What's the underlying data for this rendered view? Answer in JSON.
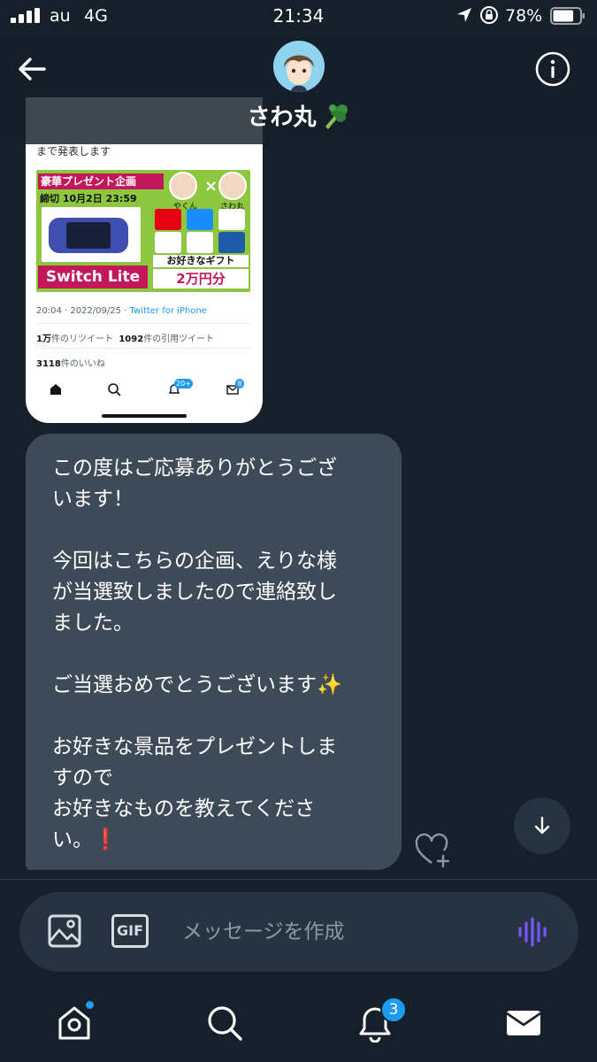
{
  "status_bar": {
    "carrier": "au",
    "network": "4G",
    "time": "21:34",
    "battery_percent": "78%",
    "battery_level": 0.78
  },
  "header": {
    "contact_name": "さわ丸",
    "name_emoji_icon": "broccoli-icon",
    "back_icon": "arrow-left-icon",
    "info_icon": "info-circle-icon"
  },
  "attached_screenshot": {
    "top_text": "まで発表します",
    "promo": {
      "heading": "豪華プレゼント企画",
      "deadline": "締切 10月2日 23:59",
      "product": "Switch Lite",
      "lite_label": "Lite",
      "times": "×",
      "host1": "やくん",
      "host2": "さわ丸",
      "gift_caption": "お好きなギフト",
      "gift_amount": "2万円分",
      "point_label": "R POINT"
    },
    "meta": {
      "datetime": "20:04 · 2022/09/25 · ",
      "via": "Twitter for iPhone"
    },
    "retweets": "1万",
    "retweets_label": "件のリツイート",
    "quotes": "1092",
    "quotes_label": "件の引用ツイート",
    "likes": "3118",
    "likes_label": "件のいいね",
    "nav_badge_notifications": "20+",
    "nav_badge_messages": "8"
  },
  "message": {
    "text": "この度はご応募ありがとうござ\nいます！\n\n今回はこちらの企画、えりな様\nが当選致しましたので連絡致し\nました。\n\nご当選おめでとうございます✨\n\nお好きな景品をプレゼントしま\nすので\nお好きなものを教えてくださ\nい。❗",
    "react_icon": "heart-add-icon"
  },
  "composer": {
    "placeholder": "メッセージを作成",
    "gif_label": "GIF",
    "image_icon": "image-icon",
    "voice_icon": "voice-wave-icon",
    "accent": "#7856ff"
  },
  "tabbar": {
    "items": [
      "home-icon",
      "search-icon",
      "bell-icon",
      "mail-icon"
    ],
    "notifications_badge": "3"
  },
  "colors": {
    "background": "#15202b",
    "bubble": "#3d4a58",
    "accent_blue": "#1d9bf0"
  }
}
